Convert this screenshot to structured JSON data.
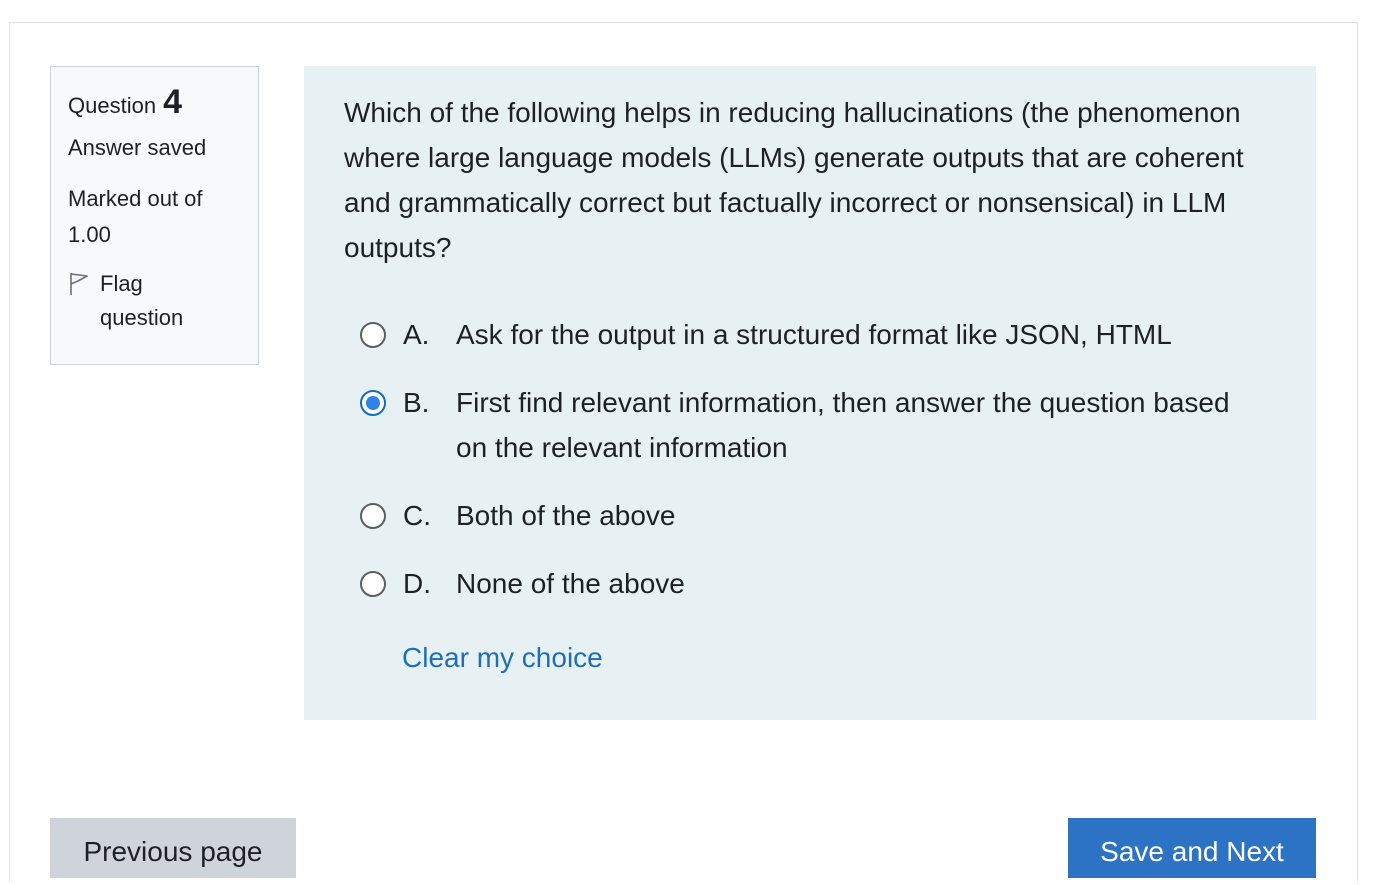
{
  "question_info": {
    "label": "Question",
    "number": "4",
    "state": "Answer saved",
    "grade_line1": "Marked out of",
    "grade_line2": "1.00",
    "flag_icon": "flag-outline-icon",
    "flag_label": "Flag question"
  },
  "question": {
    "text": "Which of the following helps in reducing hallucinations (the phenomenon where large language models (LLMs) generate outputs that are coherent and grammatically correct but factually incorrect or nonsensical) in LLM outputs?",
    "answers": [
      {
        "letter": "A.",
        "text": "Ask for the output in a structured format like JSON, HTML",
        "selected": false
      },
      {
        "letter": "B.",
        "text": "First find relevant information, then answer the question based on the relevant information",
        "selected": true
      },
      {
        "letter": "C.",
        "text": "Both of the above",
        "selected": false
      },
      {
        "letter": "D.",
        "text": "None of the above",
        "selected": false
      }
    ],
    "clear_label": "Clear my choice"
  },
  "navigation": {
    "previous_label": "Previous page",
    "next_label": "Save and Next"
  },
  "colors": {
    "accent": "#0f6cbf",
    "link": "#1e6fb7",
    "formulation_bg": "#e7f1f4",
    "next_button": "#2c73c6"
  }
}
